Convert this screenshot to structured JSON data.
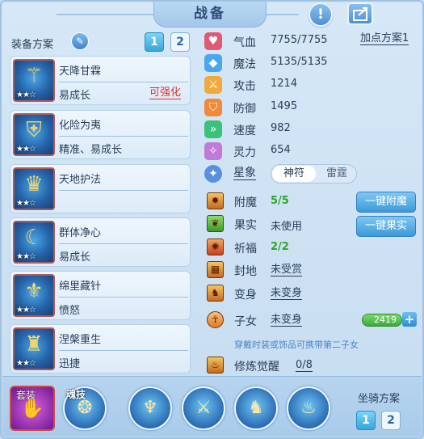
{
  "window": {
    "title": "战备"
  },
  "equip_scheme": {
    "label": "装备方案",
    "tabs": [
      {
        "label": "1",
        "active": true
      },
      {
        "label": "2",
        "active": false
      }
    ]
  },
  "equipment": [
    {
      "name": "天降甘霖",
      "stars": "★★☆",
      "sub": "易成长",
      "badge": "可强化",
      "icon": "scepter-icon"
    },
    {
      "name": "化险为夷",
      "stars": "★★☆",
      "sub": "精准、易成长",
      "badge": "",
      "icon": "armor-icon"
    },
    {
      "name": "天地护法",
      "stars": "★★☆",
      "sub": "",
      "badge": "",
      "icon": "helmet-icon"
    },
    {
      "name": "群体净心",
      "stars": "★★☆",
      "sub": "易成长",
      "badge": "",
      "icon": "necklace-icon"
    },
    {
      "name": "绵里藏针",
      "stars": "★★☆",
      "sub": "愤怒",
      "badge": "",
      "icon": "belt-icon"
    },
    {
      "name": "涅槃重生",
      "stars": "★★☆",
      "sub": "迅捷",
      "badge": "",
      "icon": "boots-icon"
    }
  ],
  "stats": [
    {
      "label": "气血",
      "value": "7755/7755",
      "icon": "heart-icon",
      "color": "#e05a74"
    },
    {
      "label": "魔法",
      "value": "5135/5135",
      "icon": "diamond-icon",
      "color": "#4aa6ee"
    },
    {
      "label": "攻击",
      "value": "1214",
      "icon": "attack-icon",
      "color": "#f2a83a"
    },
    {
      "label": "防御",
      "value": "1495",
      "icon": "shield-icon",
      "color": "#f08a3a"
    },
    {
      "label": "速度",
      "value": "982",
      "icon": "speed-icon",
      "color": "#3ac27a"
    },
    {
      "label": "灵力",
      "value": "654",
      "icon": "spirit-icon",
      "color": "#c07ad8"
    }
  ],
  "add_point": "加点方案1",
  "xingxiang": {
    "label": "星象",
    "options": [
      "神符",
      "雷霆"
    ],
    "selected": "神符"
  },
  "lower": [
    {
      "label": "附魔",
      "value": "5/5",
      "style": "green",
      "icon": "enchant-icon"
    },
    {
      "label": "果实",
      "value": "未使用",
      "style": "plain",
      "icon": "fruit-icon"
    },
    {
      "label": "祈福",
      "value": "2/2",
      "style": "green",
      "icon": "blessing-icon"
    },
    {
      "label": "封地",
      "value": "未受赏",
      "style": "ul",
      "icon": "fief-icon"
    },
    {
      "label": "变身",
      "value": "未变身",
      "style": "ul",
      "icon": "transform-icon"
    },
    {
      "label": "子女",
      "value": "未变身",
      "style": "ul",
      "icon": "child-icon"
    }
  ],
  "buttons": {
    "enchant": "一键附魔",
    "fruit": "一键果实"
  },
  "child_bar": {
    "value": "2419",
    "plus": "+"
  },
  "note": "穿戴时装或饰品可携带第二子女",
  "awaken": {
    "label": "修炼觉醒",
    "value": "0/8"
  },
  "bottom": {
    "suit_label": "套装",
    "skill_label": "魂技",
    "mount_label": "坐骑方案",
    "mount_tabs": [
      {
        "label": "1",
        "active": true
      },
      {
        "label": "2",
        "active": false
      }
    ]
  }
}
